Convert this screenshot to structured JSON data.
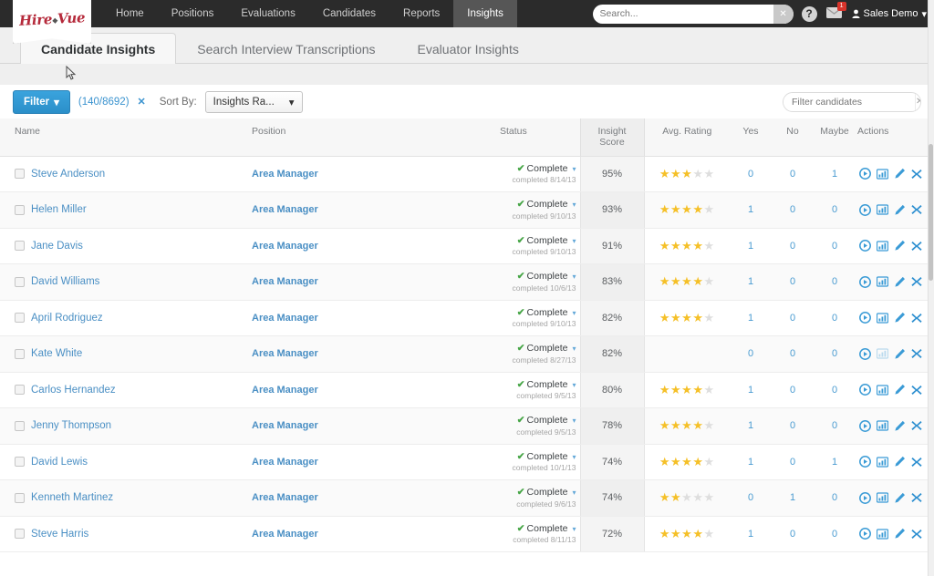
{
  "topnav": {
    "logo_text": "Hire",
    "logo_text2": "Vue",
    "links": [
      {
        "label": "Home",
        "active": false
      },
      {
        "label": "Positions",
        "active": false
      },
      {
        "label": "Evaluations",
        "active": false
      },
      {
        "label": "Candidates",
        "active": false
      },
      {
        "label": "Reports",
        "active": false
      },
      {
        "label": "Insights",
        "active": true
      }
    ],
    "search": {
      "value": "",
      "placeholder": "Search...",
      "clear_label": "✕"
    },
    "help_label": "?",
    "notifications_badge": "1",
    "user_label": "Sales Demo",
    "user_caret": "⌵"
  },
  "tabs": [
    {
      "label": "Candidate Insights",
      "active": true
    },
    {
      "label": "Search Interview Transcriptions",
      "active": false
    },
    {
      "label": "Evaluator Insights",
      "active": false
    }
  ],
  "filterbar": {
    "filter_label": "Filter",
    "filter_caret": "▾",
    "count": "(140/8692)",
    "count_clear": "✕",
    "sort_label": "Sort By:",
    "sort_value": "Insights Ra...",
    "sort_caret": "▾",
    "candidate_filter": {
      "value": "",
      "placeholder": "Filter candidates",
      "clear_label": "✕"
    }
  },
  "table": {
    "headers": {
      "name": "Name",
      "position": "Position",
      "status": "Status",
      "score_line1": "Insight",
      "score_line2": "Score",
      "rating": "Avg. Rating",
      "yes": "Yes",
      "no": "No",
      "maybe": "Maybe",
      "actions": "Actions"
    },
    "status_text": "Complete",
    "status_tick": "✔",
    "status_caret": "▾",
    "rows": [
      {
        "name": "Steve Anderson",
        "position": "Area Manager",
        "status": "Complete",
        "completed": "completed 8/14/13",
        "score": "95%",
        "stars": 3,
        "yes": "0",
        "no": "0",
        "maybe": "1",
        "chart_enabled": true
      },
      {
        "name": "Helen Miller",
        "position": "Area Manager",
        "status": "Complete",
        "completed": "completed 9/10/13",
        "score": "93%",
        "stars": 4,
        "yes": "1",
        "no": "0",
        "maybe": "0",
        "chart_enabled": true
      },
      {
        "name": "Jane Davis",
        "position": "Area Manager",
        "status": "Complete",
        "completed": "completed 9/10/13",
        "score": "91%",
        "stars": 4,
        "yes": "1",
        "no": "0",
        "maybe": "0",
        "chart_enabled": true
      },
      {
        "name": "David Williams",
        "position": "Area Manager",
        "status": "Complete",
        "completed": "completed 10/6/13",
        "score": "83%",
        "stars": 4,
        "yes": "1",
        "no": "0",
        "maybe": "0",
        "chart_enabled": true
      },
      {
        "name": "April Rodriguez",
        "position": "Area Manager",
        "status": "Complete",
        "completed": "completed 9/10/13",
        "score": "82%",
        "stars": 4,
        "yes": "1",
        "no": "0",
        "maybe": "0",
        "chart_enabled": true
      },
      {
        "name": "Kate White",
        "position": "Area Manager",
        "status": "Complete",
        "completed": "completed 8/27/13",
        "score": "82%",
        "stars": 0,
        "yes": "0",
        "no": "0",
        "maybe": "0",
        "chart_enabled": false
      },
      {
        "name": "Carlos Hernandez",
        "position": "Area Manager",
        "status": "Complete",
        "completed": "completed 9/5/13",
        "score": "80%",
        "stars": 4,
        "yes": "1",
        "no": "0",
        "maybe": "0",
        "chart_enabled": true
      },
      {
        "name": "Jenny Thompson",
        "position": "Area Manager",
        "status": "Complete",
        "completed": "completed 9/5/13",
        "score": "78%",
        "stars": 4,
        "yes": "1",
        "no": "0",
        "maybe": "0",
        "chart_enabled": true
      },
      {
        "name": "David Lewis",
        "position": "Area Manager",
        "status": "Complete",
        "completed": "completed 10/1/13",
        "score": "74%",
        "stars": 4,
        "yes": "1",
        "no": "0",
        "maybe": "1",
        "chart_enabled": true
      },
      {
        "name": "Kenneth Martinez",
        "position": "Area Manager",
        "status": "Complete",
        "completed": "completed 9/6/13",
        "score": "74%",
        "stars": 2,
        "yes": "0",
        "no": "1",
        "maybe": "0",
        "chart_enabled": true
      },
      {
        "name": "Steve Harris",
        "position": "Area Manager",
        "status": "Complete",
        "completed": "completed 8/11/13",
        "score": "72%",
        "stars": 4,
        "yes": "1",
        "no": "0",
        "maybe": "0",
        "chart_enabled": true
      }
    ],
    "max_stars": 5,
    "star_glyph": "★",
    "actions": [
      "play-icon",
      "chart-icon",
      "edit-icon",
      "delete-icon"
    ]
  },
  "colors": {
    "accent_blue": "#3a93cf",
    "link_blue": "#4a8fc4",
    "star_gold": "#f5c028",
    "status_green": "#46a546",
    "nav_dark": "#2b2b2b",
    "logo_red": "#b5293a"
  }
}
